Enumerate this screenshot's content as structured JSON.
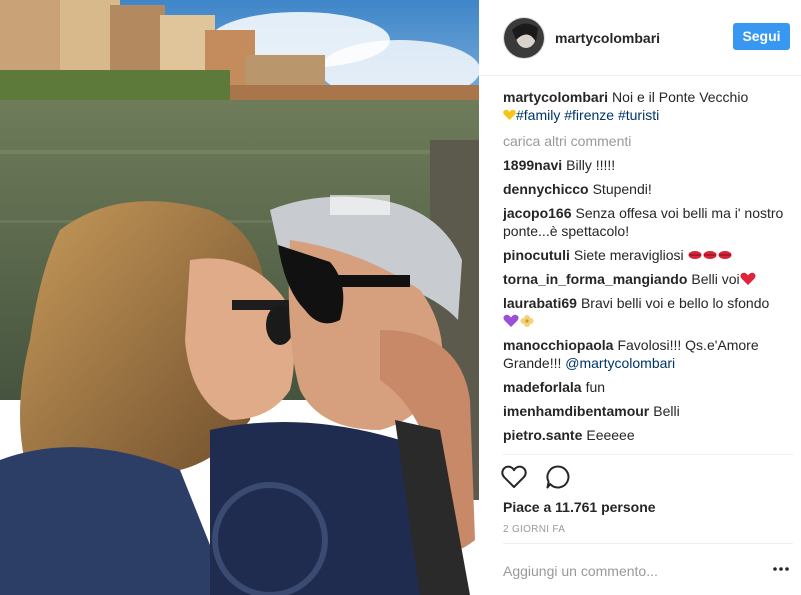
{
  "post": {
    "header": {
      "username": "martycolombari",
      "follow_label": "Segui"
    },
    "caption": {
      "username": "martycolombari",
      "text": "Noi e il Ponte Vecchio",
      "hashtags": [
        "#family",
        "#firenze",
        "#turisti"
      ]
    },
    "load_more_label": "carica altri commenti",
    "comments": [
      {
        "user": "1899navi",
        "text": "Billy !!!!!"
      },
      {
        "user": "dennychicco",
        "text": "Stupendi!"
      },
      {
        "user": "jacopo166",
        "text": "Senza offesa voi belli ma i' nostro ponte...è spettacolo!"
      },
      {
        "user": "pinocutuli",
        "text": "Siete meravigliosi"
      },
      {
        "user": "torna_in_forma_mangiando",
        "text": "Belli voi"
      },
      {
        "user": "laurabati69",
        "text": "Bravi belli voi e bello lo sfondo"
      },
      {
        "user": "manocchiopaola",
        "text": "Favolosi!!! Qs.e'Amore Grande!!!",
        "mention": "@martycolombari"
      },
      {
        "user": "madeforlala",
        "text": "fun"
      },
      {
        "user": "imenhamdibentamour",
        "text": "Belli"
      },
      {
        "user": "pietro.sante",
        "text": "Eeeeee"
      }
    ],
    "likes_text": "Piace a 11.761 persone",
    "time_ago": "2 GIORNI FA",
    "add_comment_placeholder": "Aggiungi un commento...",
    "icons": {
      "like": "heart-outline-icon",
      "comment": "speech-bubble-icon",
      "more": "ellipsis-icon"
    },
    "colors": {
      "follow_button": "#3897f0",
      "hashtag": "#003569",
      "muted": "#999999",
      "text": "#262626"
    }
  }
}
